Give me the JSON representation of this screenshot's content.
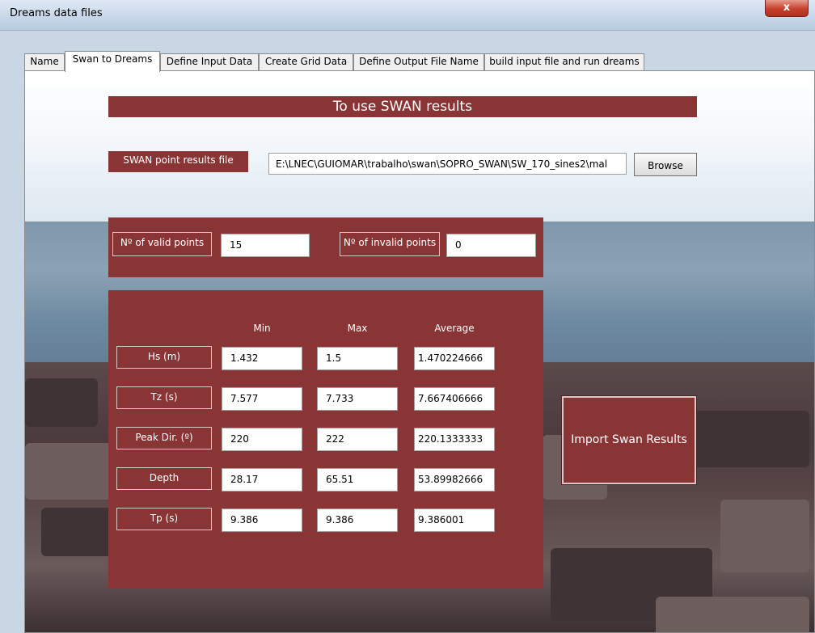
{
  "window": {
    "title": "Dreams data files",
    "close_label": "x"
  },
  "tabs": [
    {
      "label": "Name"
    },
    {
      "label": "Swan to Dreams"
    },
    {
      "label": "Define Input Data"
    },
    {
      "label": "Create Grid Data"
    },
    {
      "label": "Define Output File Name"
    },
    {
      "label": "build input file and run dreams"
    }
  ],
  "header": {
    "title": "To use SWAN results"
  },
  "file": {
    "label": "SWAN point results file",
    "path": "E:\\LNEC\\GUIOMAR\\trabalho\\swan\\SOPRO_SWAN\\SW_170_sines2\\mal",
    "browse_label": "Browse"
  },
  "points": {
    "valid_label": "Nº of valid points",
    "valid_value": "15",
    "invalid_label": "Nº of invalid points",
    "invalid_value": "0"
  },
  "stats": {
    "columns": [
      "Min",
      "Max",
      "Average"
    ],
    "rows": [
      {
        "label": "Hs (m)",
        "min": "1.432",
        "max": "1.5",
        "avg": "1.470224666"
      },
      {
        "label": "Tz (s)",
        "min": "7.577",
        "max": "7.733",
        "avg": "7.667406666"
      },
      {
        "label": "Peak Dir. (º)",
        "min": "220",
        "max": "222",
        "avg": "220.1333333"
      },
      {
        "label": "Depth",
        "min": "28.17",
        "max": "65.51",
        "avg": "53.89982666"
      },
      {
        "label": "Tp (s)",
        "min": "9.386",
        "max": "9.386",
        "avg": "9.386001"
      }
    ]
  },
  "import_button": {
    "label": "Import Swan Results"
  },
  "colors": {
    "panel": "#8a3535",
    "panel_border": "#d8c8c8"
  }
}
